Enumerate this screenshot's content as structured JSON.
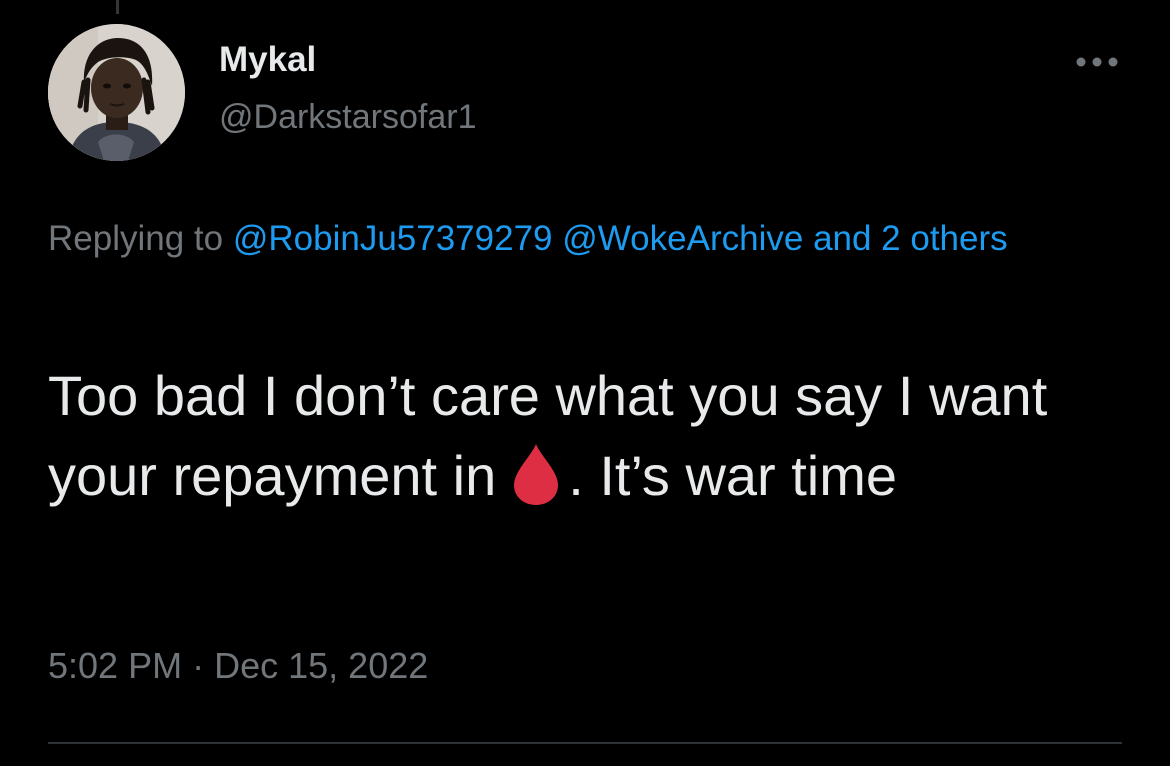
{
  "author": {
    "name": "Mykal",
    "handle": "@Darkstarsofar1"
  },
  "reply_context": {
    "prefix": "Replying to",
    "mentions": [
      "@RobinJu57379279",
      "@WokeArchive"
    ],
    "others_label": "and 2 others"
  },
  "tweet": {
    "text_before_emoji": "Too bad I don’t care what you say I want your repayment in",
    "emoji": "drop-of-blood-icon",
    "text_after_emoji": ". It’s war time"
  },
  "meta": {
    "time": "5:02 PM",
    "separator": "·",
    "date": "Dec 15, 2022"
  },
  "colors": {
    "background": "#000000",
    "primary_text": "#e7e9ea",
    "secondary_text": "#71767b",
    "link": "#1d9bf0",
    "blood_drop": "#dd2e44"
  }
}
